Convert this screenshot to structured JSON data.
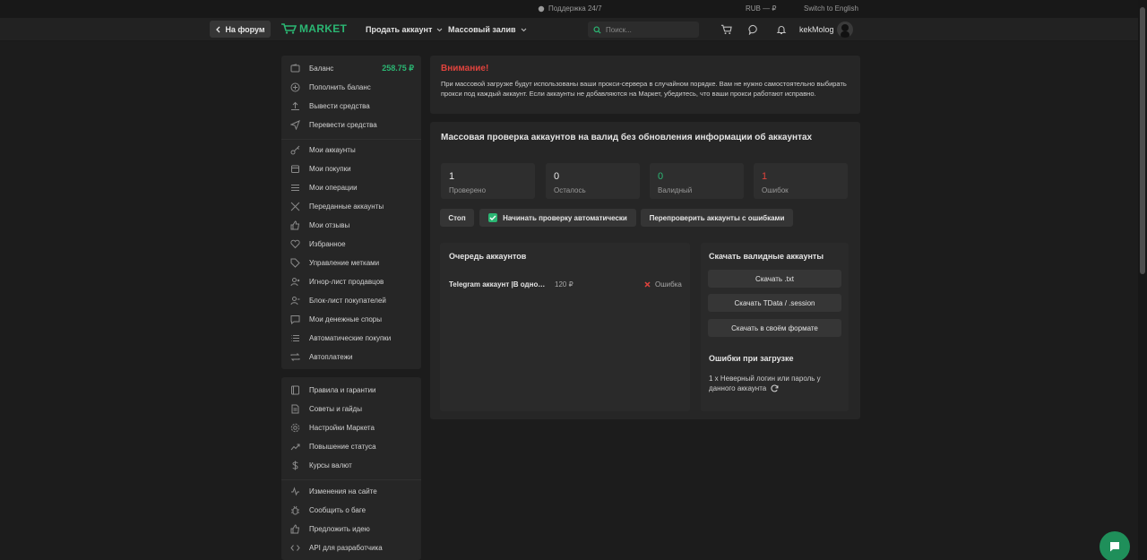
{
  "topbar": {
    "support": "Поддержка 24/7",
    "currency": "RUB — ₽",
    "language": "Switch to English"
  },
  "header": {
    "forum_button": "На форум",
    "logo": "MARKET",
    "nav": [
      "Продать аккаунт",
      "Массовый залив"
    ],
    "search_placeholder": "Поиск...",
    "username": "kekMolog"
  },
  "sidebar": {
    "balance_label": "Баланс",
    "balance_value": "258.75 ₽",
    "group1": [
      {
        "label": "Пополнить баланс",
        "icon": "plus-circle-icon"
      },
      {
        "label": "Вывести средства",
        "icon": "upload-icon"
      },
      {
        "label": "Перевести средства",
        "icon": "send-icon"
      }
    ],
    "group2": [
      {
        "label": "Мои аккаунты",
        "icon": "key-icon"
      },
      {
        "label": "Мои покупки",
        "icon": "box-icon"
      },
      {
        "label": "Мои операции",
        "icon": "list-icon"
      },
      {
        "label": "Переданные аккаунты",
        "icon": "transfer-icon"
      },
      {
        "label": "Мои отзывы",
        "icon": "thumb-up-icon"
      },
      {
        "label": "Избранное",
        "icon": "heart-icon"
      },
      {
        "label": "Управление метками",
        "icon": "tag-icon"
      },
      {
        "label": "Игнор-лист продавцов",
        "icon": "user-ignore-icon"
      },
      {
        "label": "Блок-лист покупателей",
        "icon": "user-block-icon"
      },
      {
        "label": "Мои денежные споры",
        "icon": "message-icon"
      },
      {
        "label": "Автоматические покупки",
        "icon": "list-icon"
      },
      {
        "label": "Автоплатежи",
        "icon": "repeat-icon"
      }
    ],
    "group3": [
      {
        "label": "Правила и гарантии",
        "icon": "book-icon"
      },
      {
        "label": "Советы и гайды",
        "icon": "document-icon"
      },
      {
        "label": "Настройки Маркета",
        "icon": "gear-icon"
      },
      {
        "label": "Повышение статуса",
        "icon": "trend-up-icon"
      },
      {
        "label": "Курсы валют",
        "icon": "dollar-icon"
      }
    ],
    "group4": [
      {
        "label": "Изменения на сайте",
        "icon": "activity-icon"
      },
      {
        "label": "Сообщить о баге",
        "icon": "bug-icon"
      },
      {
        "label": "Предложить идею",
        "icon": "thumb-up-icon"
      },
      {
        "label": "API для разработчика",
        "icon": "code-icon"
      }
    ]
  },
  "warning": {
    "title": "Внимание!",
    "text": "При массовой загрузке будут использованы ваши прокси-сервера в случайном порядке. Вам не нужно самостоятельно выбирать прокси под каждый аккаунт. Если аккаунты не добавляются на Маркет, убедитесь, что ваши прокси работают исправно."
  },
  "check": {
    "title": "Массовая проверка аккаунтов на валид без обновления информации об аккаунтах",
    "stats": [
      {
        "value": "1",
        "label": "Проверено",
        "color": "#e8e8e8"
      },
      {
        "value": "0",
        "label": "Осталось",
        "color": "#e8e8e8"
      },
      {
        "value": "0",
        "label": "Валидный",
        "color": "#2bb673"
      },
      {
        "value": "1",
        "label": "Ошибок",
        "color": "#e0433d"
      }
    ],
    "stop_button": "Стоп",
    "auto_check_label": "Начинать проверку автоматически",
    "auto_check_checked": true,
    "recheck_button": "Перепроверить аккаунты с ошибками",
    "queue": {
      "title": "Очередь аккаунтов",
      "rows": [
        {
          "name": "Telegram аккаунт |В одном...",
          "price": "120 ₽",
          "status": "Ошибка"
        }
      ]
    },
    "download": {
      "title": "Скачать валидные аккаунты",
      "buttons": [
        "Скачать .txt",
        "Скачать TData / .session",
        "Скачать в своём формате"
      ],
      "errors_title": "Ошибки при загрузке",
      "error_text": "1 x Неверный логин или пароль у данного аккаунта"
    }
  },
  "colors": {
    "accent": "#2bb673",
    "danger": "#e0433d",
    "panel": "#262626",
    "background": "#1c1c1c"
  }
}
